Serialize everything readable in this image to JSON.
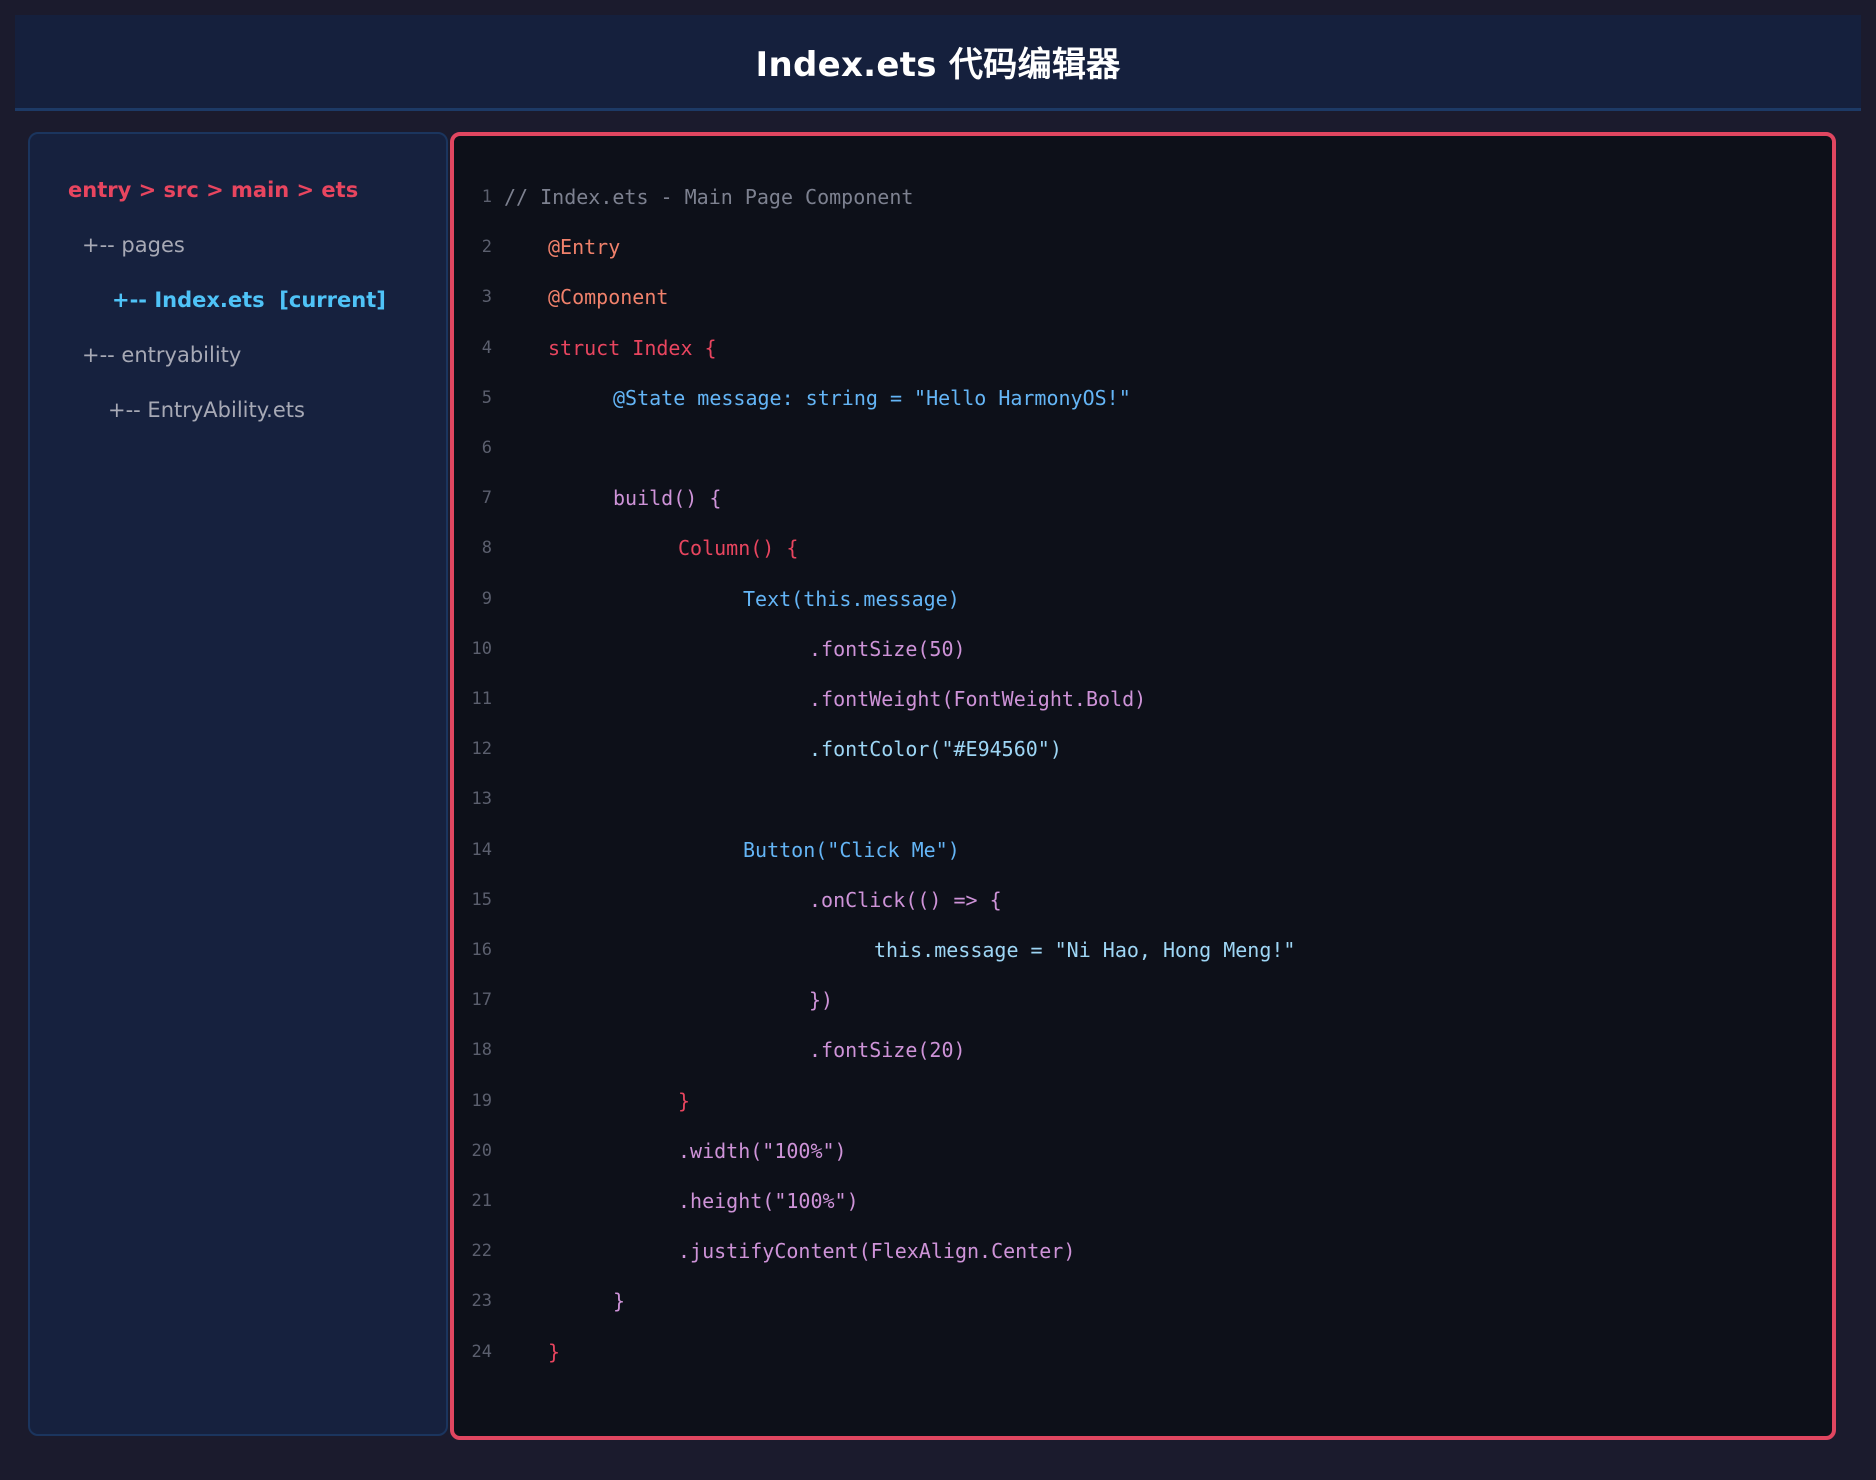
{
  "window": {
    "title": "Index.ets 代码编辑器"
  },
  "sidebar": {
    "breadcrumb": "entry > src > main > ets",
    "items": [
      {
        "label": "+-- pages",
        "level": 1,
        "current": false
      },
      {
        "label": "+-- Index.ets  [current]",
        "level": 2,
        "current": true
      },
      {
        "label": "+-- entryability",
        "level": 1,
        "current": false
      },
      {
        "label": "+-- EntryAbility.ets",
        "level": 2,
        "current": false
      }
    ]
  },
  "editor": {
    "colors": {
      "comment": "#7d8190",
      "decorator": "#f0816b",
      "keyword": "#e8455f",
      "variable": "#64b5f6",
      "method": "#ce93d8",
      "string": "#9ed6f5",
      "line_number": "#5b5f6e",
      "border": "#e04660"
    },
    "lines": [
      {
        "num": "1",
        "indent": 0,
        "color": "comment",
        "text": "// Index.ets - Main Page Component"
      },
      {
        "num": "2",
        "indent": 1,
        "color": "decorator",
        "text": "@Entry"
      },
      {
        "num": "3",
        "indent": 1,
        "color": "decorator",
        "text": "@Component"
      },
      {
        "num": "4",
        "indent": 1,
        "color": "keyword",
        "text": "struct Index {"
      },
      {
        "num": "5",
        "indent": 2,
        "color": "variable",
        "text": "@State message: string = \"Hello HarmonyOS!\""
      },
      {
        "num": "6",
        "indent": 0,
        "color": "comment",
        "text": ""
      },
      {
        "num": "7",
        "indent": 2,
        "color": "method",
        "text": "build() {"
      },
      {
        "num": "8",
        "indent": 3,
        "color": "keyword",
        "text": "Column() {"
      },
      {
        "num": "9",
        "indent": 4,
        "color": "variable",
        "text": "Text(this.message)"
      },
      {
        "num": "10",
        "indent": 5,
        "color": "method",
        "text": ".fontSize(50)"
      },
      {
        "num": "11",
        "indent": 5,
        "color": "method",
        "text": ".fontWeight(FontWeight.Bold)"
      },
      {
        "num": "12",
        "indent": 5,
        "color": "string",
        "text": ".fontColor(\"#E94560\")"
      },
      {
        "num": "13",
        "indent": 0,
        "color": "comment",
        "text": ""
      },
      {
        "num": "14",
        "indent": 4,
        "color": "variable",
        "text": "Button(\"Click Me\")"
      },
      {
        "num": "15",
        "indent": 5,
        "color": "method",
        "text": ".onClick(() => {"
      },
      {
        "num": "16",
        "indent": 6,
        "color": "string",
        "text": "this.message = \"Ni Hao, Hong Meng!\""
      },
      {
        "num": "17",
        "indent": 5,
        "color": "method",
        "text": "})"
      },
      {
        "num": "18",
        "indent": 5,
        "color": "method",
        "text": ".fontSize(20)"
      },
      {
        "num": "19",
        "indent": 3,
        "color": "keyword",
        "text": "}"
      },
      {
        "num": "20",
        "indent": 3,
        "color": "method",
        "text": ".width(\"100%\")"
      },
      {
        "num": "21",
        "indent": 3,
        "color": "method",
        "text": ".height(\"100%\")"
      },
      {
        "num": "22",
        "indent": 3,
        "color": "method",
        "text": ".justifyContent(FlexAlign.Center)"
      },
      {
        "num": "23",
        "indent": 2,
        "color": "method",
        "text": "}"
      },
      {
        "num": "24",
        "indent": 1,
        "color": "keyword",
        "text": "}"
      }
    ]
  }
}
